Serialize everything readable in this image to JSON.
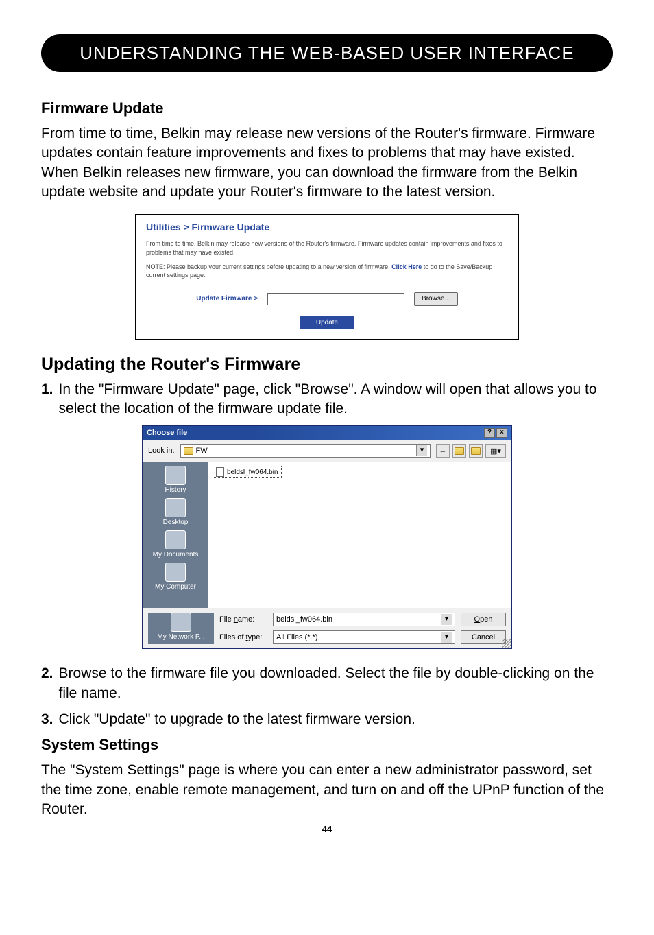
{
  "titleBar": "UNDERSTANDING THE WEB-BASED USER INTERFACE",
  "s1": {
    "heading": "Firmware Update",
    "para": "From time to time, Belkin may release new versions of the Router's firmware. Firmware updates contain feature improvements and fixes to problems that may have existed. When Belkin releases new firmware, you can download the firmware from the Belkin update website and update your Router's firmware to the latest version."
  },
  "utilPanel": {
    "title": "Utilities > Firmware Update",
    "line1": "From time to time, Belkin may release new versions of the Router's firmware. Firmware updates contain improvements and fixes to problems that may have existed.",
    "line2a": "NOTE: Please backup your current settings before updating to a new version of firmware. ",
    "line2link": "Click Here",
    "line2b": " to go to the Save/Backup current settings page.",
    "rowLabel": "Update Firmware >",
    "browseBtn": "Browse...",
    "updateBtn": "Update"
  },
  "s2": {
    "heading": "Updating the Router's Firmware",
    "item1num": "1.",
    "item1": "In the \"Firmware Update\" page, click \"Browse\". A window will open that allows you to select the location of the firmware update file."
  },
  "dlg": {
    "title": "Choose file",
    "help": "?",
    "close": "×",
    "lookinLabel": "Look in:",
    "lookinVal": "FW",
    "back": "←",
    "sidebar": {
      "history": "History",
      "desktop": "Desktop",
      "docs": "My Documents",
      "comp": "My Computer",
      "net": "My Network P..."
    },
    "fileEntry": "beldsl_fw064.bin",
    "fileNameLabelA": "File ",
    "fileNameLabelB": "n",
    "fileNameLabelC": "ame:",
    "fileNameVal": "beldsl_fw064.bin",
    "fileTypeLabelA": "Files of ",
    "fileTypeLabelB": "t",
    "fileTypeLabelC": "ype:",
    "fileTypeVal": "All Files (*.*)",
    "openA": "O",
    "openB": "pen",
    "cancel": "Cancel"
  },
  "s3": {
    "item2num": "2.",
    "item2": "Browse to the firmware file you downloaded. Select the file by double-clicking on the file name.",
    "item3num": "3.",
    "item3": "Click \"Update\" to upgrade to the latest firmware version."
  },
  "s4": {
    "heading": "System Settings",
    "para": "The \"System Settings\" page is where you can enter a new administrator password, set the time zone, enable remote management, and turn on and off the UPnP function of the Router."
  },
  "pageNumber": "44"
}
